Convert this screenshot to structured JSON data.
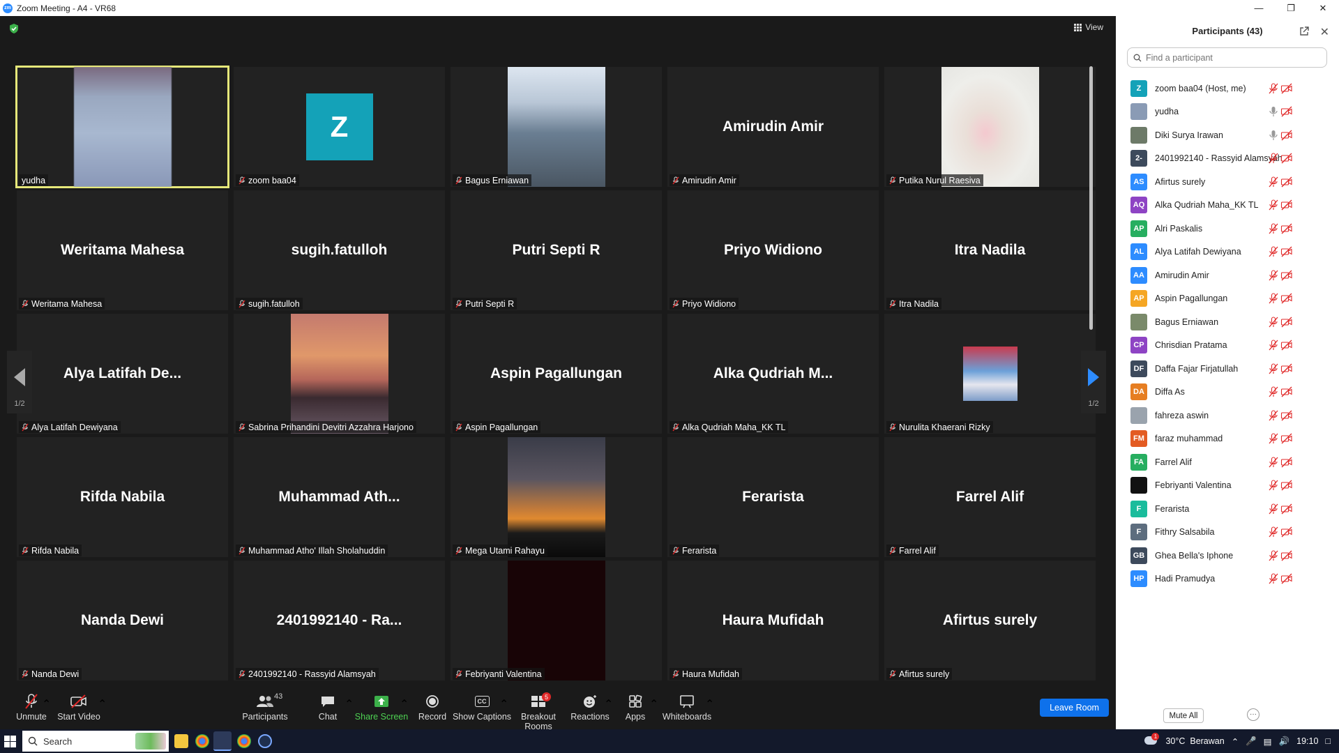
{
  "window": {
    "title": "Zoom Meeting - A4 - VR68",
    "app_icon_text": "zm"
  },
  "meeting": {
    "view_label": "View",
    "page_indicator_left": "1/2",
    "page_indicator_right": "1/2",
    "tiles": [
      {
        "big": "",
        "label": "yudha",
        "muted": false,
        "kind": "blur",
        "active": true
      },
      {
        "big": "",
        "label": "zoom baa04",
        "muted": true,
        "kind": "avatar",
        "avatar": "Z"
      },
      {
        "big": "",
        "label": "Bagus Erniawan",
        "muted": true,
        "kind": "photo-worker"
      },
      {
        "big": "Amirudin Amir",
        "label": "Amirudin Amir",
        "muted": true,
        "kind": "name"
      },
      {
        "big": "",
        "label": "Putika Nurul Raesiva",
        "muted": true,
        "kind": "photo-flowers"
      },
      {
        "big": "Weritama Mahesa",
        "label": "Weritama Mahesa",
        "muted": true,
        "kind": "name"
      },
      {
        "big": "sugih.fatulloh",
        "label": "sugih.fatulloh",
        "muted": true,
        "kind": "name"
      },
      {
        "big": "Putri Septi R",
        "label": "Putri Septi R",
        "muted": true,
        "kind": "name"
      },
      {
        "big": "Priyo Widiono",
        "label": "Priyo Widiono",
        "muted": true,
        "kind": "name"
      },
      {
        "big": "Itra Nadila",
        "label": "Itra Nadila",
        "muted": true,
        "kind": "name"
      },
      {
        "big": "Alya  Latifah  De...",
        "label": "Alya Latifah Dewiyana",
        "muted": true,
        "kind": "name"
      },
      {
        "big": "",
        "label": "Sabrina Prihandini Devitri Azzahra Harjono",
        "muted": true,
        "kind": "photo-sunset"
      },
      {
        "big": "Aspin Pagallungan",
        "label": "Aspin Pagallungan",
        "muted": true,
        "kind": "name"
      },
      {
        "big": "Alka  Qudriah  M...",
        "label": "Alka Qudriah Maha_KK TL",
        "muted": true,
        "kind": "name"
      },
      {
        "big": "",
        "label": "Nurulita Khaerani Rizky",
        "muted": true,
        "kind": "photo-small"
      },
      {
        "big": "Rifda Nabila",
        "label": "Rifda Nabila",
        "muted": true,
        "kind": "name"
      },
      {
        "big": "Muhammad  Ath...",
        "label": "Muhammad Atho' Illah Sholahuddin",
        "muted": true,
        "kind": "name"
      },
      {
        "big": "",
        "label": "Mega Utami Rahayu",
        "muted": true,
        "kind": "photo-dusk"
      },
      {
        "big": "Ferarista",
        "label": "Ferarista",
        "muted": true,
        "kind": "name"
      },
      {
        "big": "Farrel Alif",
        "label": "Farrel Alif",
        "muted": true,
        "kind": "name"
      },
      {
        "big": "Nanda Dewi",
        "label": "Nanda Dewi",
        "muted": true,
        "kind": "name"
      },
      {
        "big": "2401992140 - Ra...",
        "label": "2401992140 - Rassyid Alamsyah",
        "muted": true,
        "kind": "name"
      },
      {
        "big": "",
        "label": "Febriyanti Valentina",
        "muted": true,
        "kind": "photo-dark"
      },
      {
        "big": "Haura Mufidah",
        "label": "Haura Mufidah",
        "muted": true,
        "kind": "name"
      },
      {
        "big": "Afirtus surely",
        "label": "Afirtus surely",
        "muted": true,
        "kind": "name"
      }
    ]
  },
  "toolbar": {
    "unmute": "Unmute",
    "start_video": "Start Video",
    "participants": "Participants",
    "participants_count": "43",
    "chat": "Chat",
    "share_screen": "Share Screen",
    "record": "Record",
    "captions": "Show Captions",
    "captions_icon": "CC",
    "breakout": "Breakout Rooms",
    "breakout_badge": "5",
    "reactions": "Reactions",
    "apps": "Apps",
    "whiteboards": "Whiteboards",
    "leave": "Leave Room"
  },
  "panel": {
    "title": "Participants (43)",
    "search_placeholder": "Find a participant",
    "mute_all": "Mute All",
    "more": "···",
    "participants": [
      {
        "initials": "Z",
        "name": "zoom baa04 (Host, me)",
        "color": "#14a2b8",
        "mic": "muted"
      },
      {
        "initials": "",
        "name": "yudha",
        "color": "#8a9bb5",
        "mic": "on"
      },
      {
        "initials": "",
        "name": "Diki Surya Irawan",
        "color": "#6d7a68",
        "mic": "on"
      },
      {
        "initials": "2-",
        "name": "2401992140 - Rassyid Alamsyah",
        "color": "#3d4a5c",
        "mic": "muted"
      },
      {
        "initials": "AS",
        "name": "Afirtus surely",
        "color": "#2d8cff",
        "mic": "muted"
      },
      {
        "initials": "AQ",
        "name": "Alka Qudriah Maha_KK TL",
        "color": "#8e44c4",
        "mic": "muted"
      },
      {
        "initials": "AP",
        "name": "Alri Paskalis",
        "color": "#27ae60",
        "mic": "muted"
      },
      {
        "initials": "AL",
        "name": "Alya Latifah Dewiyana",
        "color": "#2d8cff",
        "mic": "muted"
      },
      {
        "initials": "AA",
        "name": "Amirudin Amir",
        "color": "#2d8cff",
        "mic": "muted"
      },
      {
        "initials": "AP",
        "name": "Aspin Pagallungan",
        "color": "#f5a623",
        "mic": "muted"
      },
      {
        "initials": "",
        "name": "Bagus Erniawan",
        "color": "#7a8a6a",
        "mic": "muted"
      },
      {
        "initials": "CP",
        "name": "Chrisdian Pratama",
        "color": "#8e44c4",
        "mic": "muted"
      },
      {
        "initials": "DF",
        "name": "Daffa Fajar Firjatullah",
        "color": "#3d4a5c",
        "mic": "muted"
      },
      {
        "initials": "DA",
        "name": "Diffa As",
        "color": "#e67e22",
        "mic": "muted"
      },
      {
        "initials": "",
        "name": "fahreza aswin",
        "color": "#9aa3ad",
        "mic": "muted"
      },
      {
        "initials": "FM",
        "name": "faraz muhammad",
        "color": "#e35b22",
        "mic": "muted"
      },
      {
        "initials": "FA",
        "name": "Farrel Alif",
        "color": "#27ae60",
        "mic": "muted"
      },
      {
        "initials": "",
        "name": "Febriyanti Valentina",
        "color": "#111111",
        "mic": "muted"
      },
      {
        "initials": "F",
        "name": "Ferarista",
        "color": "#1abc9c",
        "mic": "muted"
      },
      {
        "initials": "F",
        "name": "Fithry Salsabila",
        "color": "#5d6d7e",
        "mic": "muted"
      },
      {
        "initials": "GB",
        "name": "Ghea Bella's Iphone",
        "color": "#3d4a5c",
        "mic": "muted"
      },
      {
        "initials": "HP",
        "name": "Hadi Pramudya",
        "color": "#2d8cff",
        "mic": "muted"
      }
    ]
  },
  "taskbar": {
    "search_label": "Search",
    "weather": "30°C  Berawan",
    "time": "19:10",
    "weather_badge": "1"
  }
}
